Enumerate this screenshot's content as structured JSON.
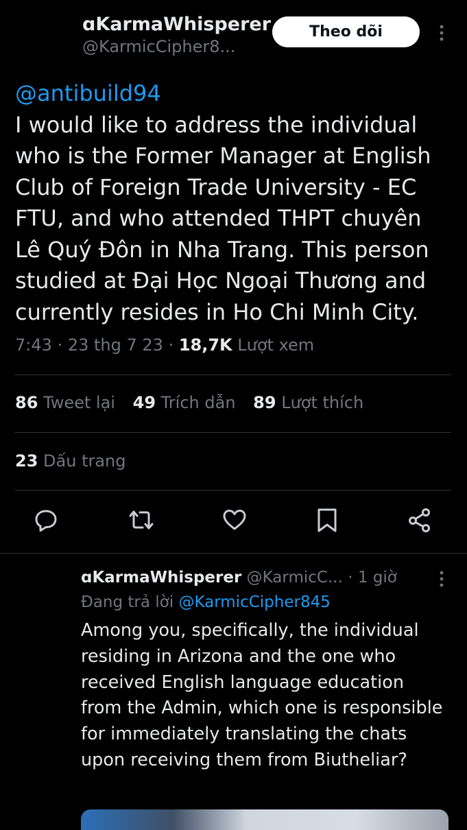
{
  "header": {
    "display_name": "ɑKarmaWhisperer",
    "handle": "@KarmicCipher8...",
    "follow_label": "Theo dõi",
    "more_icon": "more-vertical-icon"
  },
  "tweet": {
    "mention": "@antibuild94",
    "text": "I would like to address the individual who is the Former Manager at English Club of Foreign Trade University - EC FTU, and who attended THPT chuyên Lê Quý Đôn in Nha Trang. This person studied at Đại Học Ngoại Thương and currently resides in Ho Chi Minh City.",
    "time": "7:43",
    "date": "23 thg 7 23",
    "views_count": "18,7K",
    "views_label": "Lượt xem"
  },
  "stats": {
    "retweets": {
      "count": "86",
      "label": "Tweet lại"
    },
    "quotes": {
      "count": "49",
      "label": "Trích dẫn"
    },
    "likes": {
      "count": "89",
      "label": "Lượt thích"
    },
    "bookmarks": {
      "count": "23",
      "label": "Dấu trang"
    }
  },
  "actions": [
    {
      "name": "reply-icon"
    },
    {
      "name": "retweet-icon"
    },
    {
      "name": "like-icon"
    },
    {
      "name": "bookmark-icon"
    },
    {
      "name": "share-icon"
    }
  ],
  "reply": {
    "display_name": "ɑKarmaWhisperer",
    "handle": "@KarmicC...",
    "separator": "·",
    "time": "1 giờ",
    "replying_label": "Đang trả lời",
    "replying_to": "@KarmicCipher845",
    "text": "Among you, specifically, the individual residing in Arizona and the one who received English language education from the Admin, which one is responsible for immediately translating the chats upon receiving them from Biutheliar?"
  },
  "colors": {
    "background": "#000000",
    "text_primary": "#e7e9ea",
    "text_secondary": "#71767b",
    "link": "#1d9bf0",
    "divider": "#2f3336",
    "follow_bg": "#ffffff"
  }
}
